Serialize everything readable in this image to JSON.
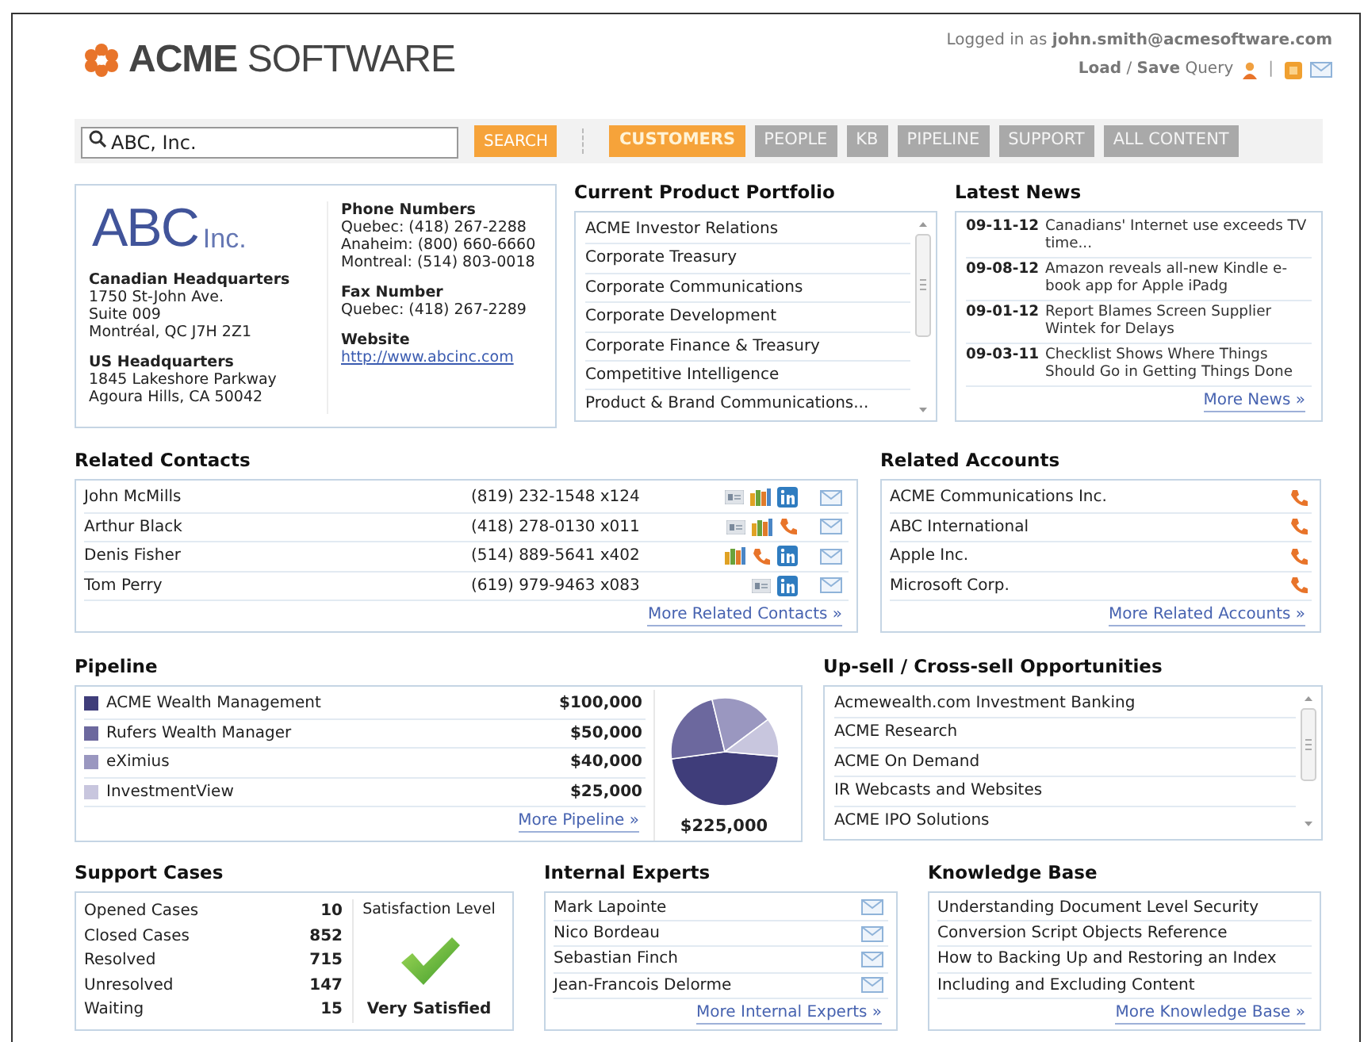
{
  "header": {
    "logo": "**ACME** SOFTWARE",
    "logged_in": "Logged in as **john.smith@acmesoftware.com**",
    "query": "**Load** / **Save** Query",
    "separator": "|"
  },
  "search": {
    "value": "ABC, Inc.",
    "button": "SEARCH"
  },
  "tabs": [
    {
      "label": "CUSTOMERS",
      "selected": true
    },
    {
      "label": "PEOPLE",
      "selected": false
    },
    {
      "label": "KB",
      "selected": false
    },
    {
      "label": "PIPELINE",
      "selected": false
    },
    {
      "label": "SUPPORT",
      "selected": false
    },
    {
      "label": "ALL CONTENT",
      "selected": false
    }
  ],
  "company": {
    "logo_main": "ABC",
    "logo_suffix": "Inc.",
    "left": [
      {
        "title": "Canadian Headquarters",
        "lines": [
          "1750 St-John Ave.",
          "Suite 009",
          "Montréal, QC J7H 2Z1"
        ]
      },
      {
        "title": "US Headquarters",
        "lines": [
          "1845 Lakeshore Parkway",
          "Agoura Hills, CA 50042"
        ]
      }
    ],
    "right": [
      {
        "title": "Phone Numbers",
        "lines": [
          "Quebec: (418) 267-2288",
          "Anaheim: (800) 660-6660",
          "Montreal: (514) 803-0018"
        ]
      },
      {
        "title": "Fax Number",
        "lines": [
          "Quebec: (418) 267-2289"
        ]
      },
      {
        "title": "Website",
        "link": "http://www.abcinc.com"
      }
    ]
  },
  "portfolio": {
    "title": "Current Product Portfolio",
    "items": [
      "ACME Investor Relations",
      "Corporate Treasury",
      "Corporate Communications",
      "Corporate Development",
      "Corporate Finance & Treasury",
      "Competitive Intelligence",
      "Product & Brand Communications..."
    ]
  },
  "news": {
    "title": "Latest News",
    "items": [
      {
        "date": "09-11-12",
        "headline": "Canadians' Internet use exceeds TV time..."
      },
      {
        "date": "09-08-12",
        "headline": "Amazon reveals all-new Kindle e-book app for Apple iPadg"
      },
      {
        "date": "09-01-12",
        "headline": "Report Blames Screen Supplier Wintek for Delays"
      },
      {
        "date": "09-03-11",
        "headline": "Checklist Shows Where Things Should Go in Getting Things Done"
      }
    ],
    "more": "More News »"
  },
  "contacts": {
    "title": "Related Contacts",
    "rows": [
      {
        "name": "John McMills",
        "phone": "(819) 232-1548 x124",
        "icons": [
          {
            "kind": "card"
          },
          {
            "kind": "org"
          },
          {
            "kind": "linkedin"
          }
        ]
      },
      {
        "name": "Arthur Black",
        "phone": "(418) 278-0130 x011",
        "icons": [
          {
            "kind": "card"
          },
          {
            "kind": "org"
          },
          {
            "kind": "phone"
          }
        ]
      },
      {
        "name": "Denis Fisher",
        "phone": "(514) 889-5641 x402",
        "icons": [
          {
            "kind": "org"
          },
          {
            "kind": "phone"
          },
          {
            "kind": "linkedin"
          }
        ]
      },
      {
        "name": "Tom Perry",
        "phone": "(619) 979-9463 x083",
        "icons": [
          {
            "kind": "card"
          },
          {
            "kind": "linkedin"
          }
        ]
      }
    ],
    "more": "More Related Contacts »"
  },
  "accounts": {
    "title": "Related Accounts",
    "items": [
      "ACME Communications Inc.",
      "ABC International",
      "Apple Inc.",
      "Microsoft Corp."
    ],
    "more": "More Related Accounts »"
  },
  "pipeline": {
    "title": "Pipeline",
    "items": [
      {
        "amount": "$100,000",
        "color": "#3f3d7a"
      },
      {
        "amount": "$50,000",
        "color": "#6c689e"
      },
      {
        "amount": "$40,000",
        "color": "#9a97c0"
      },
      {
        "amount": "$25,000",
        "color": "#c8c6de"
      }
    ],
    "more": "More Pipeline »",
    "total": "$225,000",
    "chart_data": {
      "type": "pie",
      "categories": [
        "ACME Wealth Management",
        "Rufers Wealth Manager",
        "eXimius",
        "InvestmentView"
      ],
      "values": [
        46.5,
        23.3,
        18.6,
        11.6
      ]
    }
  },
  "upsell": {
    "title": "Up-sell / Cross-sell Opportunities",
    "items": [
      "Acmewealth.com Investment Banking",
      "ACME Research",
      "ACME On Demand",
      "IR Webcasts and Websites",
      "ACME IPO Solutions"
    ]
  },
  "support": {
    "title": "Support Cases",
    "rows": [
      {
        "label": "Opened Cases",
        "value": "10"
      },
      {
        "label": "Closed Cases",
        "value": "852"
      },
      {
        "label": "Resolved",
        "value": "715"
      },
      {
        "label": "Unresolved",
        "value": "147"
      },
      {
        "label": "Waiting",
        "value": "15"
      }
    ],
    "satisfaction_title": "Satisfaction Level",
    "satisfaction": "Very Satisfied"
  },
  "experts": {
    "title": "Internal Experts",
    "items": [
      "Mark Lapointe",
      "Nico Bordeau",
      "Sebastian Finch",
      "Jean-Francois Delorme"
    ],
    "more": "More Internal Experts »"
  },
  "knowledge_base": {
    "title": "Knowledge Base",
    "items": [
      "Understanding Document Level Security",
      "Conversion Script Objects Reference",
      "How to Backing Up and Restoring an Index",
      "Including and Excluding Content"
    ],
    "more": "More Knowledge Base »"
  }
}
